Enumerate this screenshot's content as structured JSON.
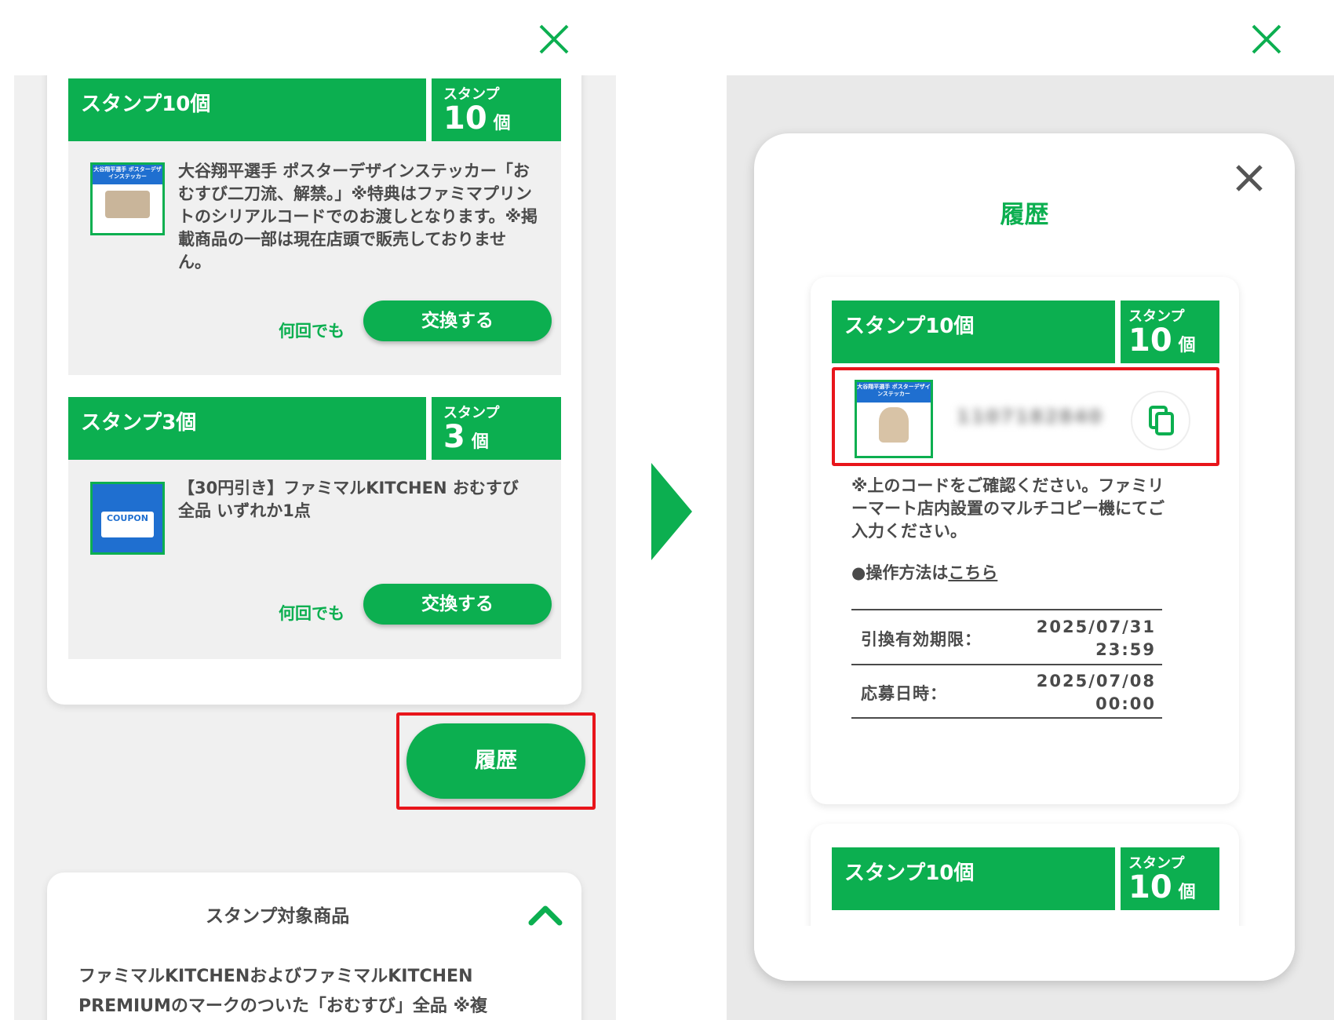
{
  "left": {
    "items": [
      {
        "title": "スタンプ10個",
        "stamp_label": "スタンプ",
        "stamp_count": "10",
        "stamp_unit": "個",
        "thumb_text": "大谷翔平選手 ポスターデザインステッカー",
        "description": "大谷翔平選手 ポスターデザインステッカー「おむすび二刀流、解禁。」※特典はファミマプリントのシリアルコードでのお渡しとなります。※掲載商品の一部は現在店頭で販売しておりません。",
        "repeat": "何回でも",
        "button": "交換する"
      },
      {
        "title": "スタンプ3個",
        "stamp_label": "スタンプ",
        "stamp_count": "3",
        "stamp_unit": "個",
        "thumb_text": "COUPON",
        "description": "【30円引き】ファミマルKITCHEN おむすび 全品 いずれか1点",
        "repeat": "何回でも",
        "button": "交換する"
      }
    ],
    "history_button": "履歴",
    "target_section": {
      "title": "スタンプ対象商品",
      "text_line1": "ファミマルKITCHENおよびファミマルKITCHEN",
      "text_line2": "PREMIUMのマークのついた「おむすび」全品 ※複"
    }
  },
  "modal": {
    "title": "履歴",
    "entries": [
      {
        "title": "スタンプ10個",
        "stamp_label": "スタンプ",
        "stamp_count": "10",
        "stamp_unit": "個",
        "thumb_text": "大谷翔平選手 ポスターデザインステッカー",
        "code_masked": "1107182840",
        "note": "※上のコードをご確認ください。ファミリーマート店内設置のマルチコピー機にてご入力ください。",
        "howto_prefix": "●操作方法は",
        "howto_link": "こちら",
        "expiry_label": "引換有効期限：",
        "expiry_date": "2025/07/31",
        "expiry_time": "23:59",
        "applied_label": "応募日時：",
        "applied_date": "2025/07/08",
        "applied_time": "00:00"
      },
      {
        "title": "スタンプ10個",
        "stamp_label": "スタンプ",
        "stamp_count": "10",
        "stamp_unit": "個"
      }
    ]
  },
  "colors": {
    "brand_green": "#0caf50",
    "highlight_red": "#e8151b",
    "panel_gray": "#f0f0f0"
  }
}
